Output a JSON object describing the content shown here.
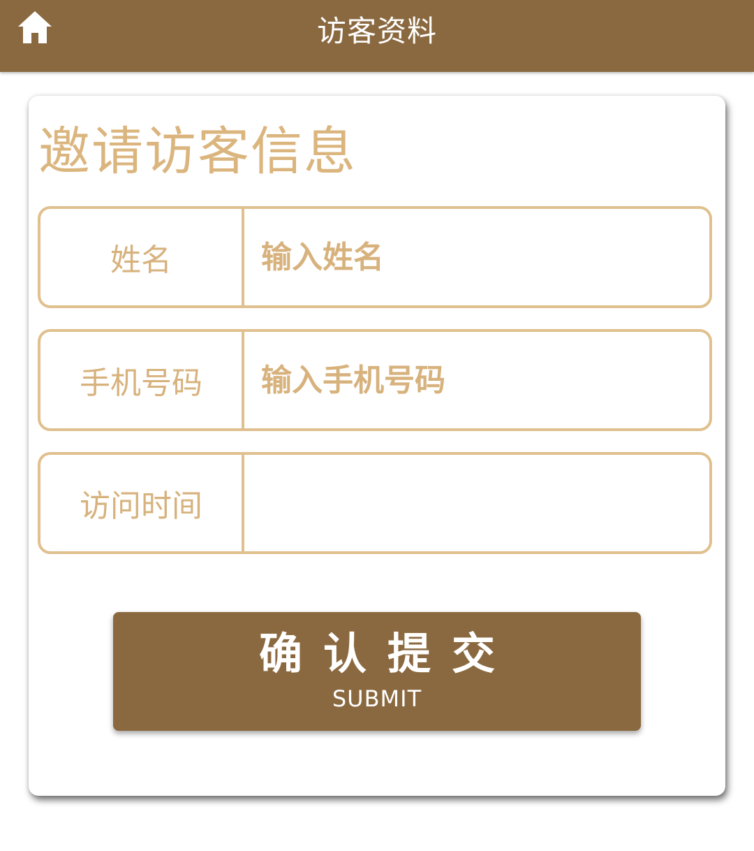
{
  "header": {
    "title": "访客资料",
    "home_icon": "home-icon"
  },
  "form": {
    "title": "邀请访客信息",
    "fields": [
      {
        "label": "姓名",
        "placeholder": "输入姓名",
        "value": ""
      },
      {
        "label": "手机号码",
        "placeholder": "输入手机号码",
        "value": ""
      },
      {
        "label": "访问时间",
        "placeholder": "",
        "value": ""
      }
    ],
    "submit": {
      "label": "确认提交",
      "sublabel": "SUBMIT"
    }
  },
  "colors": {
    "brand": "#8b6940",
    "accent": "#e0c08e",
    "label_text": "#d7b27d"
  }
}
